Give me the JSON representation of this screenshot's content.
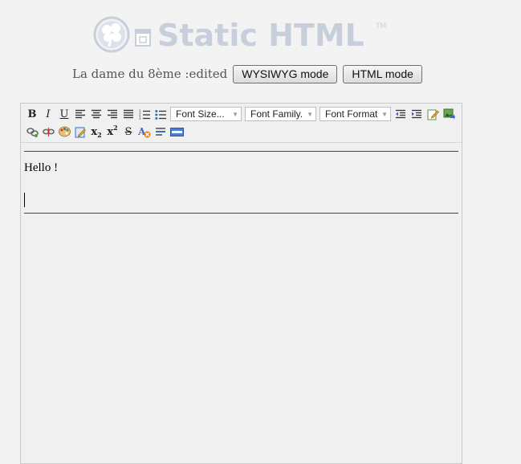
{
  "logo": {
    "text": "Static HTML",
    "tm": "TM"
  },
  "header": {
    "doc_title": "La dame du 8ème :edited",
    "wysiwyg_label": "WYSIWYG mode",
    "html_label": "HTML mode"
  },
  "toolbar": {
    "bold": "B",
    "italic": "I",
    "underline": "U",
    "font_size": "Font Size...",
    "font_family": "Font Family.",
    "font_format": "Font Format",
    "subscript": "x",
    "subscript_mark": "2",
    "superscript": "x",
    "superscript_mark": "2",
    "strikethrough": "S"
  },
  "content": {
    "text": "Hello !"
  },
  "colors": {
    "logo": "#c8cfdc",
    "accent": "#4a6fb0"
  }
}
